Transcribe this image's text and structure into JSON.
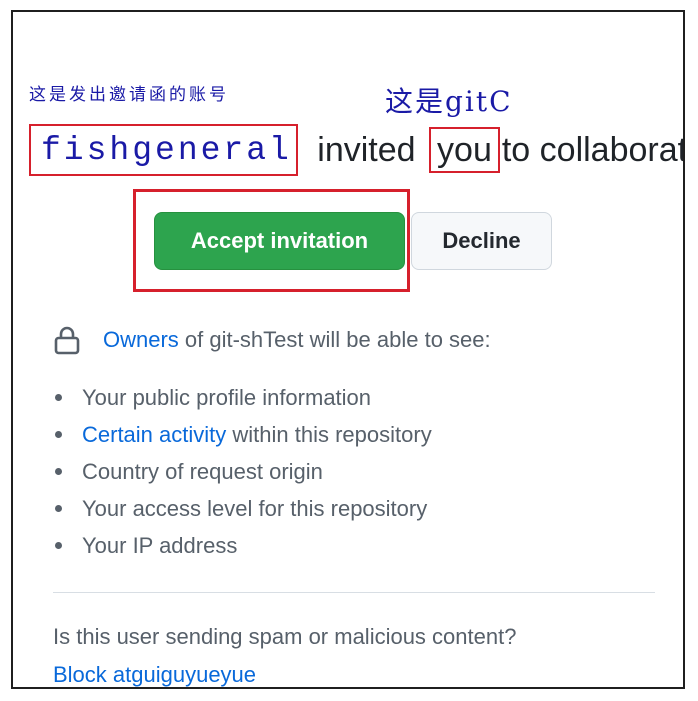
{
  "annotations": {
    "inviter_note": "这是发出邀请函的账号",
    "you_note": "这是gitC"
  },
  "invite": {
    "inviter": "fishgeneral",
    "invited_text": " invited ",
    "you": "you",
    "tail_text": "to collaborate"
  },
  "buttons": {
    "accept": "Accept invitation",
    "decline": "Decline"
  },
  "permissions": {
    "owners_link": "Owners",
    "owners_text": " of git-shTest will be able to see:",
    "items": [
      {
        "link": "",
        "text": "Your public profile information"
      },
      {
        "link": "Certain activity",
        "text": " within this repository"
      },
      {
        "link": "",
        "text": "Country of request origin"
      },
      {
        "link": "",
        "text": "Your access level for this repository"
      },
      {
        "link": "",
        "text": "Your IP address"
      }
    ]
  },
  "spam": {
    "question": "Is this user sending spam or malicious content?",
    "block_link": "Block atguiguyueyue"
  },
  "colors": {
    "accept_bg": "#2da44e",
    "link": "#0969da",
    "annotation_red": "#d6202c",
    "annotation_blue": "#1a1aa6"
  }
}
